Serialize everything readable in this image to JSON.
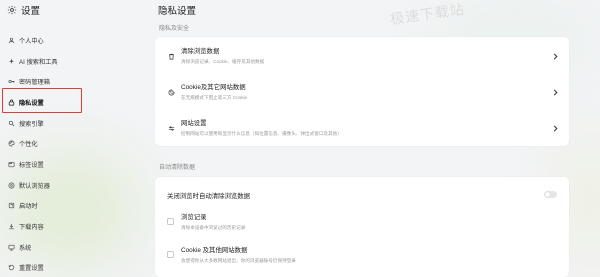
{
  "sidebar": {
    "title": "设置",
    "items": [
      {
        "label": "个人中心",
        "icon": "user-icon"
      },
      {
        "label": "AI 搜索和工具",
        "icon": "sparkle-icon"
      },
      {
        "label": "密码管理箱",
        "icon": "key-icon"
      },
      {
        "label": "隐私设置",
        "icon": "lock-icon",
        "active": true
      },
      {
        "label": "搜索引擎",
        "icon": "search-icon"
      },
      {
        "label": "个性化",
        "icon": "palette-icon"
      },
      {
        "label": "标签设置",
        "icon": "tab-icon"
      },
      {
        "label": "默认浏览器",
        "icon": "browser-icon"
      },
      {
        "label": "启动时",
        "icon": "power-icon"
      },
      {
        "label": "下载内容",
        "icon": "download-icon"
      },
      {
        "label": "系统",
        "icon": "system-icon"
      },
      {
        "label": "重置设置",
        "icon": "reset-icon"
      }
    ]
  },
  "main": {
    "title": "隐私设置",
    "privacy_section": {
      "label": "隐私及安全",
      "rows": [
        {
          "title": "清除浏览数据",
          "desc": "清除浏览记录、Cookie、缓存及其他数据",
          "icon": "trash-icon"
        },
        {
          "title": "Cookie及其它网站数据",
          "desc": "在无痕模式下阻止第三方 Cookie",
          "icon": "cookie-icon"
        },
        {
          "title": "网站设置",
          "desc": "控制网站可以使用和显示什么信息（如位置信息、摄像头、弹出式窗口及其他）",
          "icon": "sliders-icon"
        }
      ]
    },
    "auto_clear_section": {
      "label": "自动清除数据",
      "toggle_label": "关闭浏览时自动清除浏览数据",
      "options": [
        {
          "title": "浏览记录",
          "desc": "清除本设备中浏览过的历史记录"
        },
        {
          "title": "Cookie 及其他网站数据",
          "desc": "会使得你从大多数网站退出，你的浏览器账号仍保持登录"
        }
      ]
    }
  },
  "watermark": "极速下载站",
  "colors": {
    "highlight_border": "#e53935",
    "background": "#f3f4f6",
    "card": "#ffffff"
  }
}
